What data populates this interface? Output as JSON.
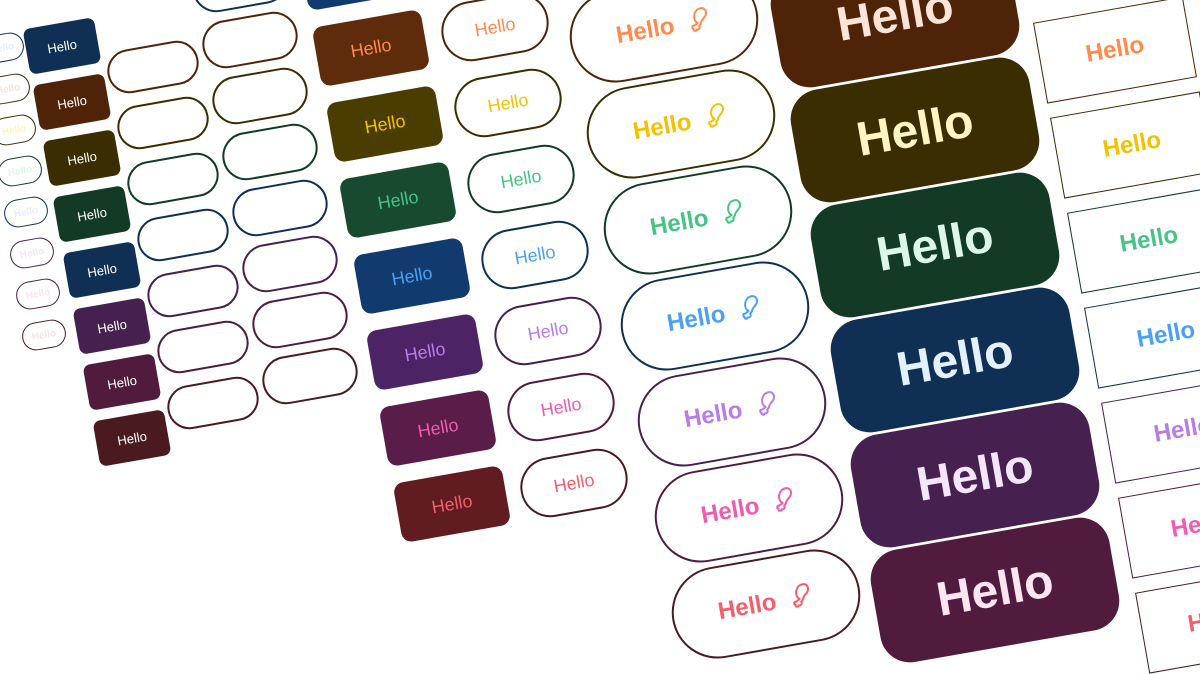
{
  "palette": {
    "orange": {
      "dark": "#4f2308",
      "mid": "#5e2b0b",
      "text": "#ff8a4c",
      "tint": "#fde4d8"
    },
    "yellow": {
      "dark": "#3a2d02",
      "mid": "#4b3d00",
      "text": "#f2c200",
      "tint": "#fff6c4"
    },
    "green": {
      "dark": "#123a25",
      "mid": "#174a2e",
      "text": "#45c486",
      "tint": "#dcf7e8"
    },
    "blue": {
      "dark": "#0f2f55",
      "mid": "#113a6e",
      "text": "#4aa0f5",
      "tint": "#e3f0fd"
    },
    "purple": {
      "dark": "#46204f",
      "mid": "#4c2465",
      "text": "#b87be8",
      "tint": "#f3e6fb"
    },
    "pink": {
      "dark": "#511b3d",
      "mid": "#5a1c48",
      "text": "#f05bb0",
      "tint": "#fde6f1"
    },
    "red": {
      "dark": "#4a1a1f",
      "mid": "#601c20",
      "text": "#f45e6a",
      "tint": "#fde3e5"
    }
  },
  "columns": [
    {
      "style": "tiny-outline",
      "label": "Hello",
      "colors": [
        "blue",
        "orange",
        "yellow",
        "green",
        "blue",
        "purple",
        "pink",
        "red"
      ]
    },
    {
      "style": "small-filled",
      "label": "Hello",
      "colors": [
        "blue",
        "orange",
        "yellow",
        "green",
        "blue",
        "purple",
        "pink",
        "red"
      ]
    },
    {
      "style": "empty-outline",
      "label": "",
      "colors": [
        "orange",
        "yellow",
        "green",
        "blue",
        "purple",
        "pink",
        "red"
      ]
    },
    {
      "style": "empty-outline-large",
      "label": "",
      "colors": [
        "blue",
        "orange",
        "yellow",
        "green",
        "blue",
        "purple",
        "pink",
        "red"
      ]
    },
    {
      "style": "medium-filled",
      "label": "Hello",
      "colors": [
        "blue",
        "orange",
        "yellow",
        "green",
        "blue",
        "purple",
        "pink",
        "red"
      ]
    },
    {
      "style": "medium-outline",
      "label": "Hello",
      "colors": [
        "orange",
        "yellow",
        "green",
        "blue",
        "purple",
        "pink",
        "red"
      ]
    },
    {
      "style": "large-outline-icon",
      "label": "Hello",
      "icon": "drumstick-icon",
      "colors": [
        "orange",
        "yellow",
        "green",
        "blue",
        "purple",
        "pink",
        "red"
      ]
    },
    {
      "style": "big-filled",
      "label": "Hello",
      "colors": [
        "orange",
        "yellow",
        "green",
        "blue",
        "purple",
        "pink"
      ]
    },
    {
      "style": "square-outline",
      "label": "Hello",
      "colors": [
        "orange",
        "yellow",
        "green",
        "blue",
        "purple",
        "pink",
        "red"
      ]
    }
  ]
}
